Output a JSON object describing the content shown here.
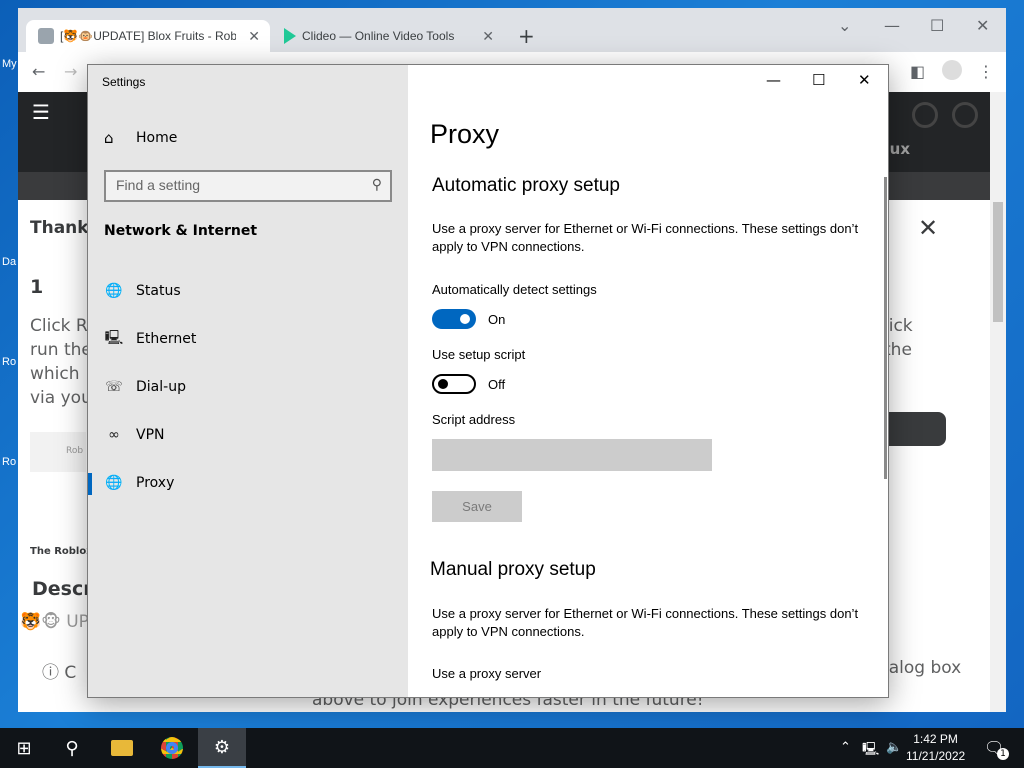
{
  "browser": {
    "tabs": [
      {
        "label": "[🐯🐵UPDATE] Blox Fruits - Rob"
      },
      {
        "label": "Clideo — Online Video Tools"
      }
    ],
    "new_tab_symbol": "+"
  },
  "desktop": {
    "icon_fragments": [
      "My",
      "Da",
      "Ro",
      "Ro"
    ]
  },
  "roblox_page": {
    "header_text": "ux",
    "modal_title": "Thanks",
    "step_number": "1",
    "instruction_lines": [
      "Click R",
      "run the",
      "which",
      "via you"
    ],
    "instruction_right": [
      "lick",
      "the"
    ],
    "thumbnail_text": "Rob",
    "footnote": "The Roblox",
    "description_title": "Descr",
    "update_text": "🐯🐵 UP",
    "bottom_left": "C",
    "bottom_right": "ialog box",
    "bottom_center": "above to join experiences faster in the future!"
  },
  "settings": {
    "window_title": "Settings",
    "home_label": "Home",
    "search_placeholder": "Find a setting",
    "section_title": "Network & Internet",
    "nav_items": [
      {
        "label": "Status",
        "icon": "status-globe-icon",
        "glyph": "🌐"
      },
      {
        "label": "Ethernet",
        "icon": "ethernet-icon",
        "glyph": "🖳"
      },
      {
        "label": "Dial-up",
        "icon": "dialup-icon",
        "glyph": "☏"
      },
      {
        "label": "VPN",
        "icon": "vpn-icon",
        "glyph": "∞"
      },
      {
        "label": "Proxy",
        "icon": "proxy-globe-icon",
        "glyph": "🌐",
        "selected": true
      }
    ],
    "page_title": "Proxy",
    "automatic": {
      "heading": "Automatic proxy setup",
      "description": "Use a proxy server for Ethernet or Wi-Fi connections. These settings don’t apply to VPN connections.",
      "auto_detect_label": "Automatically detect settings",
      "auto_detect_state": "On",
      "setup_script_label": "Use setup script",
      "setup_script_state": "Off",
      "script_address_label": "Script address",
      "script_address_value": "",
      "save_label": "Save"
    },
    "manual": {
      "heading": "Manual proxy setup",
      "description": "Use a proxy server for Ethernet or Wi-Fi connections. These settings don’t apply to VPN connections.",
      "use_proxy_label": "Use a proxy server"
    },
    "accent_color": "#0067c0"
  },
  "taskbar": {
    "time": "1:42 PM",
    "date": "11/21/2022",
    "notification_count": "1"
  }
}
